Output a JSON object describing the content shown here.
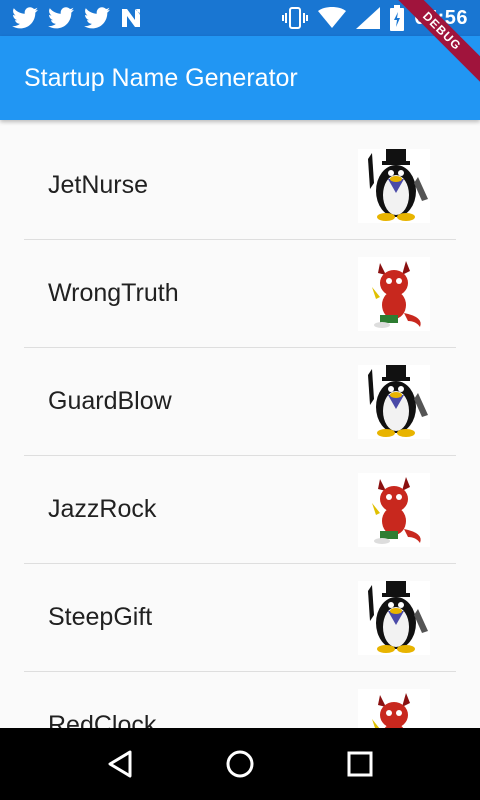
{
  "status_bar": {
    "time": "05:56",
    "left_icons": [
      "twitter-icon",
      "twitter-icon",
      "twitter-icon",
      "n-icon"
    ],
    "right_icons": [
      "vibrate-icon",
      "wifi-icon",
      "signal-icon",
      "battery-icon"
    ]
  },
  "app_bar": {
    "title": "Startup Name Generator",
    "color": "#2196f3"
  },
  "debug_banner": "DEBUG",
  "list": {
    "items": [
      {
        "name": "JetNurse",
        "image": "tux-tophat-image"
      },
      {
        "name": "WrongTruth",
        "image": "bsd-daemon-image"
      },
      {
        "name": "GuardBlow",
        "image": "tux-tophat-image"
      },
      {
        "name": "JazzRock",
        "image": "bsd-daemon-image"
      },
      {
        "name": "SteepGift",
        "image": "tux-tophat-image"
      },
      {
        "name": "RedClock",
        "image": "bsd-daemon-image"
      }
    ]
  },
  "nav_bar": {
    "buttons": [
      "back-icon",
      "home-icon",
      "recents-icon"
    ]
  }
}
